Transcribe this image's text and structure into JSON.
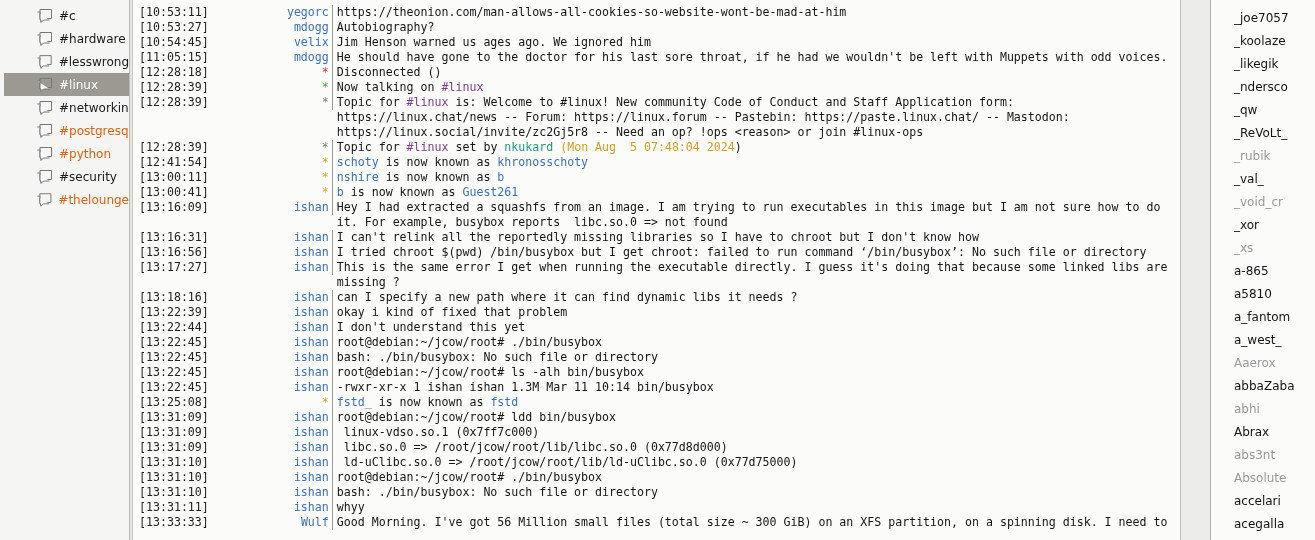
{
  "channels": [
    {
      "name": "#c",
      "selected": false,
      "highlighted": false
    },
    {
      "name": "#hardware",
      "selected": false,
      "highlighted": false
    },
    {
      "name": "#lesswrong",
      "selected": false,
      "highlighted": false
    },
    {
      "name": "#linux",
      "selected": true,
      "highlighted": false
    },
    {
      "name": "#networkin",
      "selected": false,
      "highlighted": false
    },
    {
      "name": "#postgresq",
      "selected": false,
      "highlighted": true
    },
    {
      "name": "#python",
      "selected": false,
      "highlighted": true
    },
    {
      "name": "#security",
      "selected": false,
      "highlighted": false
    },
    {
      "name": "#thelounge",
      "selected": false,
      "highlighted": true
    }
  ],
  "messages": [
    {
      "time": "[10:53:11]",
      "nick": "yegorc",
      "kind": "message",
      "text": "https://theonion.com/man-allows-all-cookies-so-website-wont-be-mad-at-him"
    },
    {
      "time": "[10:53:27]",
      "nick": "mdogg",
      "kind": "message",
      "text": "Autobiography?"
    },
    {
      "time": "[10:54:45]",
      "nick": "velix",
      "kind": "message",
      "text": "Jim Henson warned us ages ago. We ignored him"
    },
    {
      "time": "[11:05:15]",
      "nick": "mdogg",
      "kind": "message",
      "text": "He should have gone to the doctor for his last sore throat, if he had we wouldn't be left with Muppets with odd voices."
    },
    {
      "time": "[12:28:18]",
      "nick": "*",
      "kind": "error",
      "parts": [
        {
          "text": "Disconnected ()",
          "kind": "plain"
        }
      ]
    },
    {
      "time": "[12:28:39]",
      "nick": "*",
      "kind": "join",
      "parts": [
        {
          "text": "Now talking on ",
          "kind": "plain"
        },
        {
          "text": "#linux",
          "kind": "channel"
        }
      ]
    },
    {
      "time": "[12:28:39]",
      "nick": "*",
      "kind": "topic",
      "parts": [
        {
          "text": "Topic for ",
          "kind": "plain"
        },
        {
          "text": "#linux",
          "kind": "channel"
        },
        {
          "text": " is: Welcome to #linux! New community Code of Conduct and Staff Application form: https://linux.chat/news -- Forum: https://linux.forum -- Pastebin: https://paste.linux.chat/ -- Mastodon: https://linux.social/invite/zc2Gj5r8 -- Need an op? !ops <reason> or join #linux-ops",
          "kind": "plain"
        }
      ]
    },
    {
      "time": "[12:28:39]",
      "nick": "*",
      "kind": "topic",
      "parts": [
        {
          "text": "Topic for ",
          "kind": "plain"
        },
        {
          "text": "#linux",
          "kind": "channel"
        },
        {
          "text": " set by ",
          "kind": "plain"
        },
        {
          "text": "nkukard",
          "kind": "setter"
        },
        {
          "text": " (Mon Aug  5 07:48:04 2024",
          "kind": "date"
        },
        {
          "text": ")",
          "kind": "plain"
        }
      ]
    },
    {
      "time": "[12:41:54]",
      "nick": "*",
      "kind": "nick_change",
      "parts": [
        {
          "text": "schoty",
          "kind": "nick"
        },
        {
          "text": " is now known as ",
          "kind": "plain"
        },
        {
          "text": "khronosschoty",
          "kind": "nick"
        }
      ]
    },
    {
      "time": "[13:00:11]",
      "nick": "*",
      "kind": "nick_change",
      "parts": [
        {
          "text": "nshire",
          "kind": "nick"
        },
        {
          "text": " is now known as ",
          "kind": "plain"
        },
        {
          "text": "b",
          "kind": "nick"
        }
      ]
    },
    {
      "time": "[13:00:41]",
      "nick": "*",
      "kind": "nick_change",
      "parts": [
        {
          "text": "b",
          "kind": "nick"
        },
        {
          "text": " is now known as ",
          "kind": "plain"
        },
        {
          "text": "Guest261",
          "kind": "nick"
        }
      ]
    },
    {
      "time": "[13:16:09]",
      "nick": "ishan",
      "kind": "message",
      "text": "Hey I had extracted a squashfs from an image. I am trying to run executables in this image but I am not sure how to do it. For example, busybox reports  libc.so.0 => not found"
    },
    {
      "time": "[13:16:31]",
      "nick": "ishan",
      "kind": "message",
      "text": "I can't relink all the reportedly missing libraries so I have to chroot but I don't know how"
    },
    {
      "time": "[13:16:56]",
      "nick": "ishan",
      "kind": "message",
      "text": "I tried chroot $(pwd) /bin/busybox but I get chroot: failed to run command ‘/bin/busybox’: No such file or directory"
    },
    {
      "time": "[13:17:27]",
      "nick": "ishan",
      "kind": "message",
      "text": "This is the same error I get when running the executable directly. I guess it's doing that because some linked libs are missing ?"
    },
    {
      "time": "[13:18:16]",
      "nick": "ishan",
      "kind": "message",
      "text": "can I specify a new path where it can find dynamic libs it needs ?"
    },
    {
      "time": "[13:22:39]",
      "nick": "ishan",
      "kind": "message",
      "text": "okay i kind of fixed that problem"
    },
    {
      "time": "[13:22:44]",
      "nick": "ishan",
      "kind": "message",
      "text": "I don't understand this yet"
    },
    {
      "time": "[13:22:45]",
      "nick": "ishan",
      "kind": "message",
      "text": "root@debian:~/jcow/root# ./bin/busybox"
    },
    {
      "time": "[13:22:45]",
      "nick": "ishan",
      "kind": "message",
      "text": "bash: ./bin/busybox: No such file or directory"
    },
    {
      "time": "[13:22:45]",
      "nick": "ishan",
      "kind": "message",
      "text": "root@debian:~/jcow/root# ls -alh bin/busybox"
    },
    {
      "time": "[13:22:45]",
      "nick": "ishan",
      "kind": "message",
      "text": "-rwxr-xr-x 1 ishan ishan 1.3M Mar 11 10:14 bin/busybox"
    },
    {
      "time": "[13:25:08]",
      "nick": "*",
      "kind": "nick_change",
      "parts": [
        {
          "text": "fstd_",
          "kind": "nick"
        },
        {
          "text": " is now known as ",
          "kind": "plain"
        },
        {
          "text": "fstd",
          "kind": "nick"
        }
      ]
    },
    {
      "time": "[13:31:09]",
      "nick": "ishan",
      "kind": "message",
      "text": "root@debian:~/jcow/root# ldd bin/busybox"
    },
    {
      "time": "[13:31:09]",
      "nick": "ishan",
      "kind": "message",
      "text": " linux-vdso.so.1 (0x7ff7c000)"
    },
    {
      "time": "[13:31:09]",
      "nick": "ishan",
      "kind": "message",
      "text": " libc.so.0 => /root/jcow/root/lib/libc.so.0 (0x77d8d000)"
    },
    {
      "time": "[13:31:10]",
      "nick": "ishan",
      "kind": "message",
      "text": " ld-uClibc.so.0 => /root/jcow/root/lib/ld-uClibc.so.0 (0x77d75000)"
    },
    {
      "time": "[13:31:10]",
      "nick": "ishan",
      "kind": "message",
      "text": "root@debian:~/jcow/root# ./bin/busybox"
    },
    {
      "time": "[13:31:10]",
      "nick": "ishan",
      "kind": "message",
      "text": "bash: ./bin/busybox: No such file or directory"
    },
    {
      "time": "[13:31:11]",
      "nick": "ishan",
      "kind": "message",
      "text": "whyy"
    },
    {
      "time": "[13:33:33]",
      "nick": "Wulf",
      "kind": "message",
      "text": "Good Morning. I've got 56 Million small files (total size ~ 300 GiB) on an XFS partition, on a spinning disk. I need to"
    }
  ],
  "users": [
    {
      "nick": "_joe7057",
      "away": false
    },
    {
      "nick": "_koolaze",
      "away": false
    },
    {
      "nick": "_likegik",
      "away": false
    },
    {
      "nick": "_ndersco",
      "away": false
    },
    {
      "nick": "_qw",
      "away": false
    },
    {
      "nick": "_ReVoLt_",
      "away": false
    },
    {
      "nick": "_rubik",
      "away": true
    },
    {
      "nick": "_val_",
      "away": false
    },
    {
      "nick": "_void_cr",
      "away": true
    },
    {
      "nick": "_xor",
      "away": false
    },
    {
      "nick": "_xs",
      "away": true
    },
    {
      "nick": "a-865",
      "away": false
    },
    {
      "nick": "a5810",
      "away": false
    },
    {
      "nick": "a_fantom",
      "away": false
    },
    {
      "nick": "a_west_",
      "away": false
    },
    {
      "nick": "Aaerox",
      "away": true
    },
    {
      "nick": "abbaZaba",
      "away": false
    },
    {
      "nick": "abhi",
      "away": true
    },
    {
      "nick": "Abrax",
      "away": false
    },
    {
      "nick": "abs3nt",
      "away": true
    },
    {
      "nick": "Absolute",
      "away": true
    },
    {
      "nick": "accelari",
      "away": false
    },
    {
      "nick": "acegalla",
      "away": false
    }
  ]
}
